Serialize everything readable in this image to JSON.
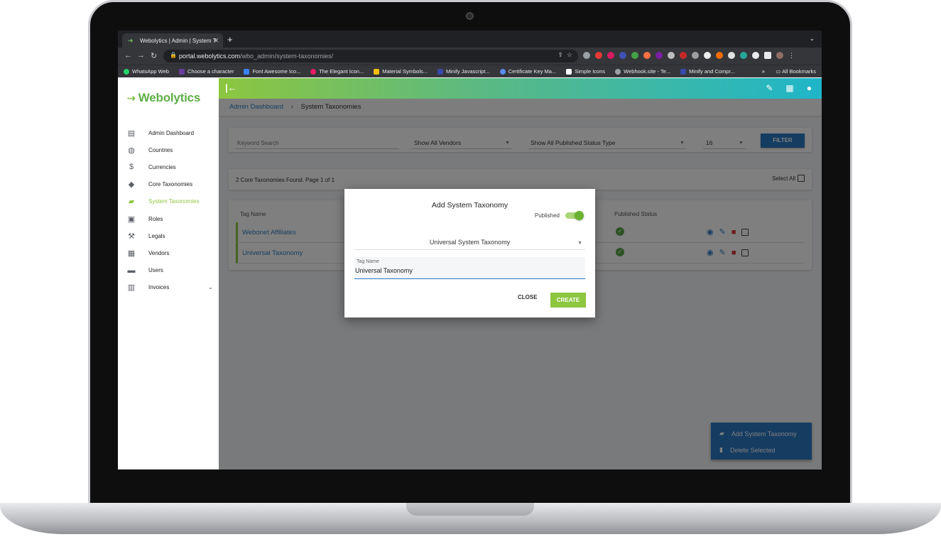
{
  "browser": {
    "tab_title": "Webolytics | Admin | System T",
    "url_host": "portal.webolytics.com",
    "url_path": "/wbo_admin/system-taxonomies/",
    "bookmarks": [
      {
        "label": "WhatsApp Web",
        "color": "#25d366"
      },
      {
        "label": "Choose a character",
        "color": "#6b3fa0"
      },
      {
        "label": "Font Awesome Ico...",
        "color": "#3b82f6"
      },
      {
        "label": "The Elegant Icon...",
        "color": "#e91e63"
      },
      {
        "label": "Material Symbols...",
        "color": "#fbbc04"
      },
      {
        "label": "Minify Javascript...",
        "color": "#3949ab"
      },
      {
        "label": "Certificate Key Ma...",
        "color": "#5b8def"
      },
      {
        "label": "Simple Icons",
        "color": "#ffffff"
      },
      {
        "label": "Webhook.site - Te...",
        "color": "#9aa0a6"
      },
      {
        "label": "Minify and Compr...",
        "color": "#3949ab"
      }
    ],
    "bookmarks_more": "»",
    "all_bookmarks": "All Bookmarks"
  },
  "app": {
    "logo_text": "Webolytics",
    "nav": [
      {
        "label": "Admin Dashboard",
        "icon": "dashboard-icon"
      },
      {
        "label": "Countries",
        "icon": "globe-icon"
      },
      {
        "label": "Currencies",
        "icon": "dollar-icon"
      },
      {
        "label": "Core Taxonomies",
        "icon": "tags-icon"
      },
      {
        "label": "System Taxonomies",
        "icon": "tag-icon",
        "active": true
      },
      {
        "label": "Roles",
        "icon": "lock-icon"
      },
      {
        "label": "Legals",
        "icon": "gavel-icon"
      },
      {
        "label": "Vendors",
        "icon": "building-icon"
      },
      {
        "label": "Users",
        "icon": "users-folder-icon"
      },
      {
        "label": "Invoices",
        "icon": "wallet-icon"
      }
    ],
    "accent": "#8dc63f",
    "primary": "#2b78c2"
  },
  "breadcrumb": {
    "parent": "Admin Dashboard",
    "current": "System Taxonomies"
  },
  "filters": {
    "keyword_placeholder": "Keyword Search",
    "vendor_select": "Show All Vendors",
    "status_select": "Show All Published Status Type",
    "page_size": "16",
    "filter_button": "FILTER"
  },
  "results": {
    "found_text": "2 Core Taxonomies Found. Page 1 of 1",
    "select_all": "Select All"
  },
  "table": {
    "headers": {
      "tag_name": "Tag Name",
      "published_status": "Published Status"
    },
    "rows": [
      {
        "name": "Webonet Affiliates",
        "published": true
      },
      {
        "name": "Universal Taxonomy",
        "published": true
      }
    ]
  },
  "fab": {
    "add_label": "Add System Taxonomy",
    "delete_label": "Delete Selected"
  },
  "modal": {
    "title": "Add System Taxonomy",
    "published_label": "Published",
    "published_on": true,
    "type_select": "Universal System Taxonomy",
    "tag_name_label": "Tag Name",
    "tag_name_value": "Universal Taxonomy",
    "close_button": "CLOSE",
    "create_button": "CREATE"
  }
}
